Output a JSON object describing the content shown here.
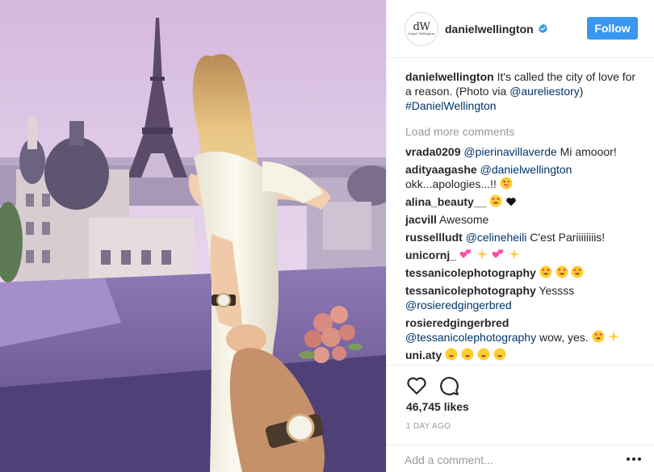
{
  "post": {
    "author": "danielwellington",
    "avatar_monogram": "dW",
    "avatar_sub": "Daniel Wellington",
    "verified": true,
    "follow_label": "Follow",
    "caption": {
      "username": "danielwellington",
      "text": "It's called the city of love for a reason. (Photo via ",
      "mention": "@aureliestory",
      "text_after": ")",
      "hashtag": "#DanielWellington"
    },
    "load_more_label": "Load more comments",
    "comments": [
      {
        "username": "vrada0209",
        "mention": "@pierinavillaverde",
        "text": " Mi amooor!"
      },
      {
        "username": "adityaagashe",
        "mention": "@danielwellington",
        "text": " okk...apologies...!!"
      },
      {
        "username": "alina_beauty__",
        "mention": "",
        "text": ""
      },
      {
        "username": "jacvill",
        "mention": "",
        "text": " Awesome"
      },
      {
        "username": "russellludt",
        "mention": "@celineheili",
        "text": " C'est Pariiiiiiiis!"
      },
      {
        "username": "unicornj_",
        "mention": "",
        "text": ""
      },
      {
        "username": "tessanicolephotography",
        "mention": "",
        "text": ""
      },
      {
        "username": "tessanicolephotography",
        "mention": "",
        "text": " Yessss "
      },
      {
        "username": "rosieredgingerbred",
        "mention": "@tessanicolephotography",
        "text": " wow, yes."
      },
      {
        "username": "uni.aty",
        "mention": "",
        "text": ""
      }
    ],
    "extra_mention": "@rosieredgingerbred",
    "likes": "46,745 likes",
    "timestamp": "1 DAY AGO",
    "add_comment_placeholder": "Add a comment...",
    "more_label": "•••"
  },
  "colors": {
    "accent": "#3897f0",
    "link": "#003569",
    "muted": "#999999",
    "text": "#262626"
  },
  "icons": [
    "heart-icon",
    "comment-bubble-icon",
    "verified-badge-icon",
    "more-options-icon"
  ]
}
